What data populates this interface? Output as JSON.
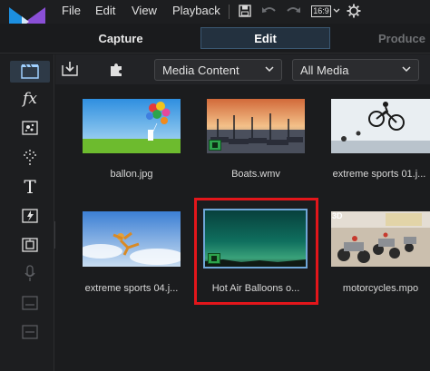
{
  "menu": {
    "file": "File",
    "edit": "Edit",
    "view": "View",
    "playback": "Playback"
  },
  "toolbar": {
    "aspect_ratio": "16:9",
    "icons": [
      "save-icon",
      "undo-icon",
      "redo-icon",
      "aspect-ratio-icon",
      "settings-gear-icon"
    ]
  },
  "modes": {
    "capture": "Capture",
    "edit": "Edit",
    "produce": "Produce",
    "active": "Edit"
  },
  "left_tools": [
    "media-room-icon",
    "fx-icon",
    "particle-icon",
    "transition-icon",
    "title-icon",
    "pip-icon",
    "chapter-icon",
    "microphone-icon",
    "subtitle-icon",
    "audio-mixing-icon"
  ],
  "library": {
    "content_dropdown": "Media Content",
    "filter_dropdown": "All Media",
    "items": [
      {
        "caption": "ballon.jpg",
        "kind": "image"
      },
      {
        "caption": "Boats.wmv",
        "kind": "video"
      },
      {
        "caption": "extreme sports 01.j...",
        "kind": "image"
      },
      {
        "caption": "extreme sports 04.j...",
        "kind": "image"
      },
      {
        "caption": "Hot Air Balloons o...",
        "kind": "video",
        "selected": true
      },
      {
        "caption": "motorcycles.mpo",
        "kind": "3d",
        "badge": "3D"
      }
    ]
  },
  "colors": {
    "accent": "#3b5873",
    "selection": "#e3161b",
    "video_badge": "#2ea34c"
  }
}
